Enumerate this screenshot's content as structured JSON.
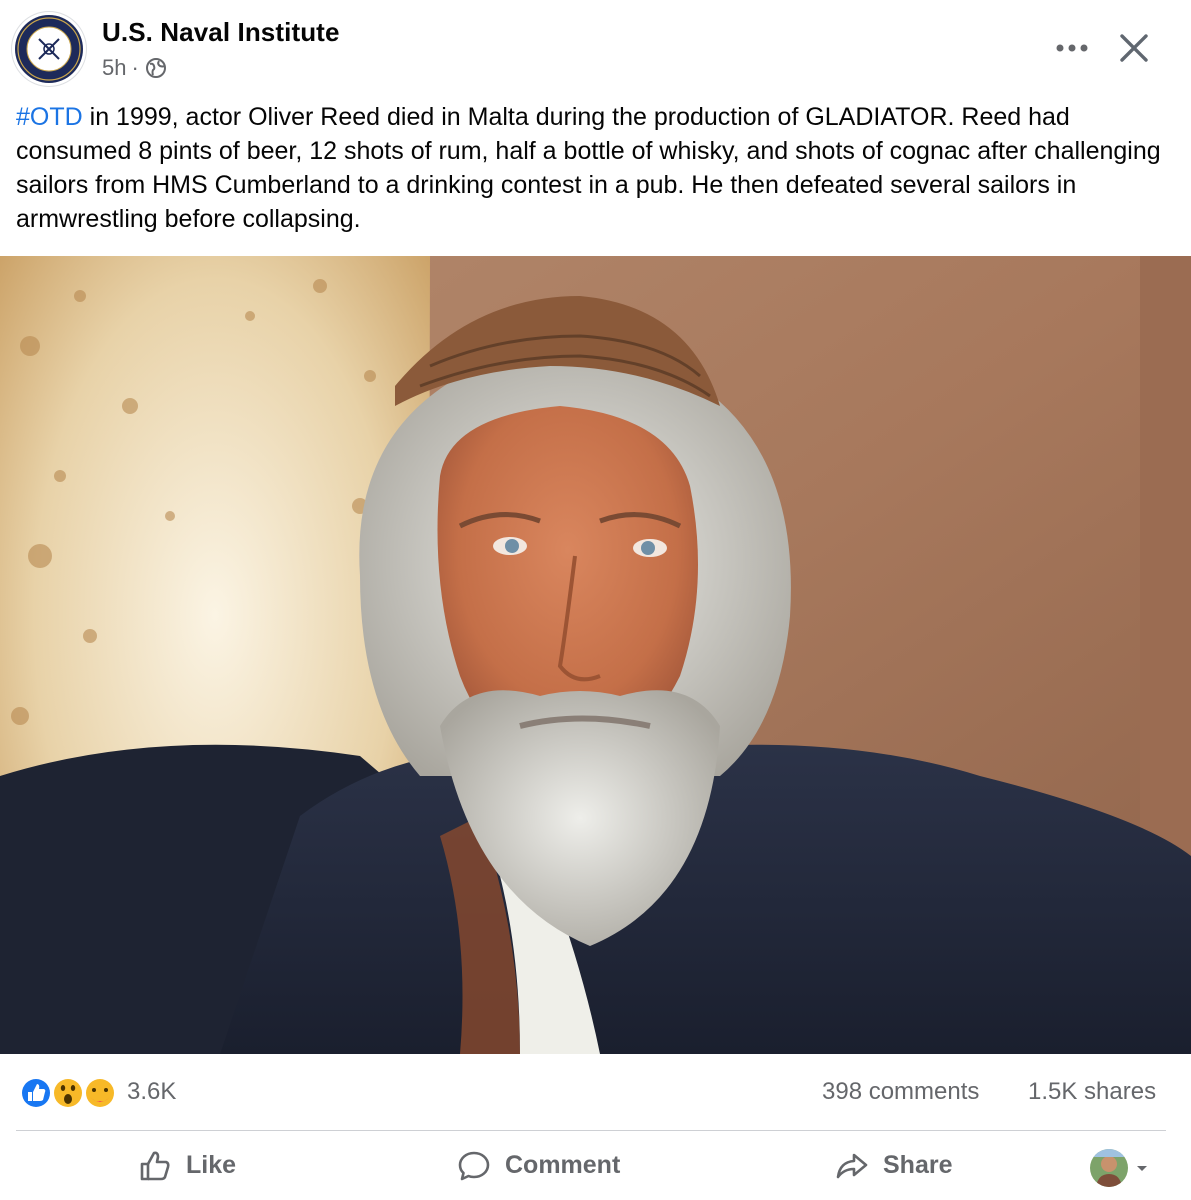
{
  "header": {
    "page_name": "U.S. Naval Institute",
    "time": "5h",
    "separator": "·",
    "more_icon": "more-horizontal-icon",
    "close_icon": "close-icon",
    "privacy_icon": "globe-icon"
  },
  "post": {
    "hashtag": "#OTD",
    "text": " in 1999, actor Oliver Reed died in Malta during the production of GLADIATOR. Reed had consumed 8 pints of beer, 12 shots of rum, half a bottle of whisky, and shots of cognac after challenging sailors from HMS Cumberland to a drinking contest in a pub. He then defeated several sailors in armwrestling before collapsing."
  },
  "stats": {
    "reactions": "3.6K",
    "comments": "398 comments",
    "shares": "1.5K shares",
    "reaction_types": [
      "like",
      "wow",
      "care"
    ]
  },
  "actions": {
    "like": "Like",
    "comment": "Comment",
    "share": "Share"
  },
  "colors": {
    "link": "#1b74e4",
    "secondary_text": "#65676b",
    "divider": "#ced0d4",
    "like_blue": "#1877f2",
    "reaction_yellow": "#f7b928"
  }
}
